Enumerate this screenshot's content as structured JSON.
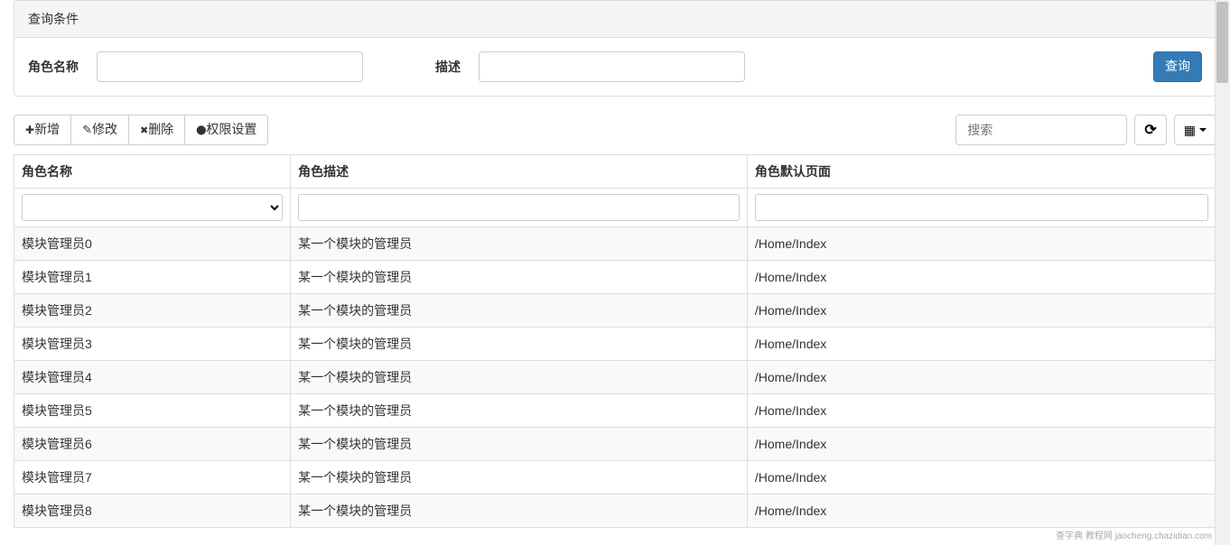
{
  "query_panel": {
    "title": "查询条件",
    "role_name_label": "角色名称",
    "role_name_value": "",
    "desc_label": "描述",
    "desc_value": "",
    "query_button": "查询"
  },
  "toolbar": {
    "add": "新增",
    "edit": "修改",
    "delete": "删除",
    "permission": "权限设置",
    "search_placeholder": "搜索"
  },
  "table": {
    "headers": {
      "name": "角色名称",
      "desc": "角色描述",
      "page": "角色默认页面"
    },
    "rows": [
      {
        "name": "模块管理员0",
        "desc": "某一个模块的管理员",
        "page": "/Home/Index"
      },
      {
        "name": "模块管理员1",
        "desc": "某一个模块的管理员",
        "page": "/Home/Index"
      },
      {
        "name": "模块管理员2",
        "desc": "某一个模块的管理员",
        "page": "/Home/Index"
      },
      {
        "name": "模块管理员3",
        "desc": "某一个模块的管理员",
        "page": "/Home/Index"
      },
      {
        "name": "模块管理员4",
        "desc": "某一个模块的管理员",
        "page": "/Home/Index"
      },
      {
        "name": "模块管理员5",
        "desc": "某一个模块的管理员",
        "page": "/Home/Index"
      },
      {
        "name": "模块管理员6",
        "desc": "某一个模块的管理员",
        "page": "/Home/Index"
      },
      {
        "name": "模块管理员7",
        "desc": "某一个模块的管理员",
        "page": "/Home/Index"
      },
      {
        "name": "模块管理员8",
        "desc": "某一个模块的管理员",
        "page": "/Home/Index"
      }
    ]
  },
  "watermark": "查字典 教程网 jaocheng.chazidian.com"
}
